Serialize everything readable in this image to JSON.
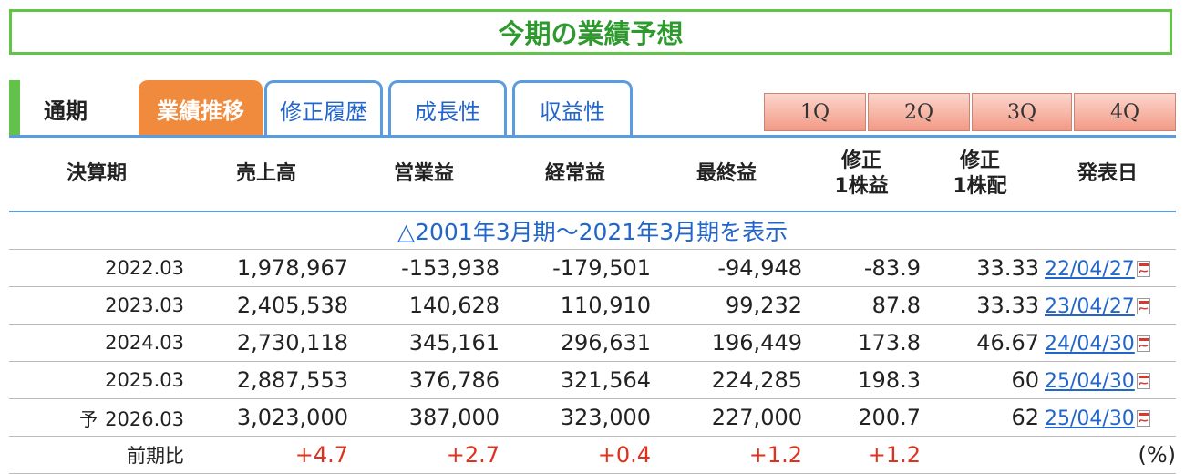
{
  "page_title": "今期の業績予想",
  "tabs": {
    "period": "通期",
    "active": "業績推移",
    "links": [
      "修正履歴",
      "成長性",
      "収益性"
    ]
  },
  "quarters": [
    "1Q",
    "2Q",
    "3Q",
    "4Q"
  ],
  "table": {
    "headers": {
      "period": "決算期",
      "sales": "売上高",
      "op_income": "営業益",
      "ord_income": "経常益",
      "net_income": "最終益",
      "eps_line1": "修正",
      "eps_line2": "1株益",
      "dps_line1": "修正",
      "dps_line2": "1株配",
      "date": "発表日"
    },
    "expand_link": "△2001年3月期～2021年3月期を表示",
    "rows": [
      {
        "forecast": "",
        "period": "2022.03",
        "sales": "1,978,967",
        "op": "-153,938",
        "ord": "-179,501",
        "net": "-94,948",
        "eps": "-83.9",
        "dps": "33.33",
        "date": "22/04/27"
      },
      {
        "forecast": "",
        "period": "2023.03",
        "sales": "2,405,538",
        "op": "140,628",
        "ord": "110,910",
        "net": "99,232",
        "eps": "87.8",
        "dps": "33.33",
        "date": "23/04/27"
      },
      {
        "forecast": "",
        "period": "2024.03",
        "sales": "2,730,118",
        "op": "345,161",
        "ord": "296,631",
        "net": "196,449",
        "eps": "173.8",
        "dps": "46.67",
        "date": "24/04/30"
      },
      {
        "forecast": "",
        "period": "2025.03",
        "sales": "2,887,553",
        "op": "376,786",
        "ord": "321,564",
        "net": "224,285",
        "eps": "198.3",
        "dps": "60",
        "date": "25/04/30"
      },
      {
        "forecast": "予",
        "period": "2026.03",
        "sales": "3,023,000",
        "op": "387,000",
        "ord": "323,000",
        "net": "227,000",
        "eps": "200.7",
        "dps": "62",
        "date": "25/04/30"
      }
    ],
    "yoy": {
      "label": "前期比",
      "sales": "+4.7",
      "op": "+2.7",
      "ord": "+0.4",
      "net": "+1.2",
      "eps": "+1.2",
      "unit": "(%)"
    }
  },
  "colors": {
    "accent_green": "#62c24a",
    "active_tab": "#f08a3c",
    "link_blue": "#2266cc",
    "positive_red": "#e0301e"
  }
}
